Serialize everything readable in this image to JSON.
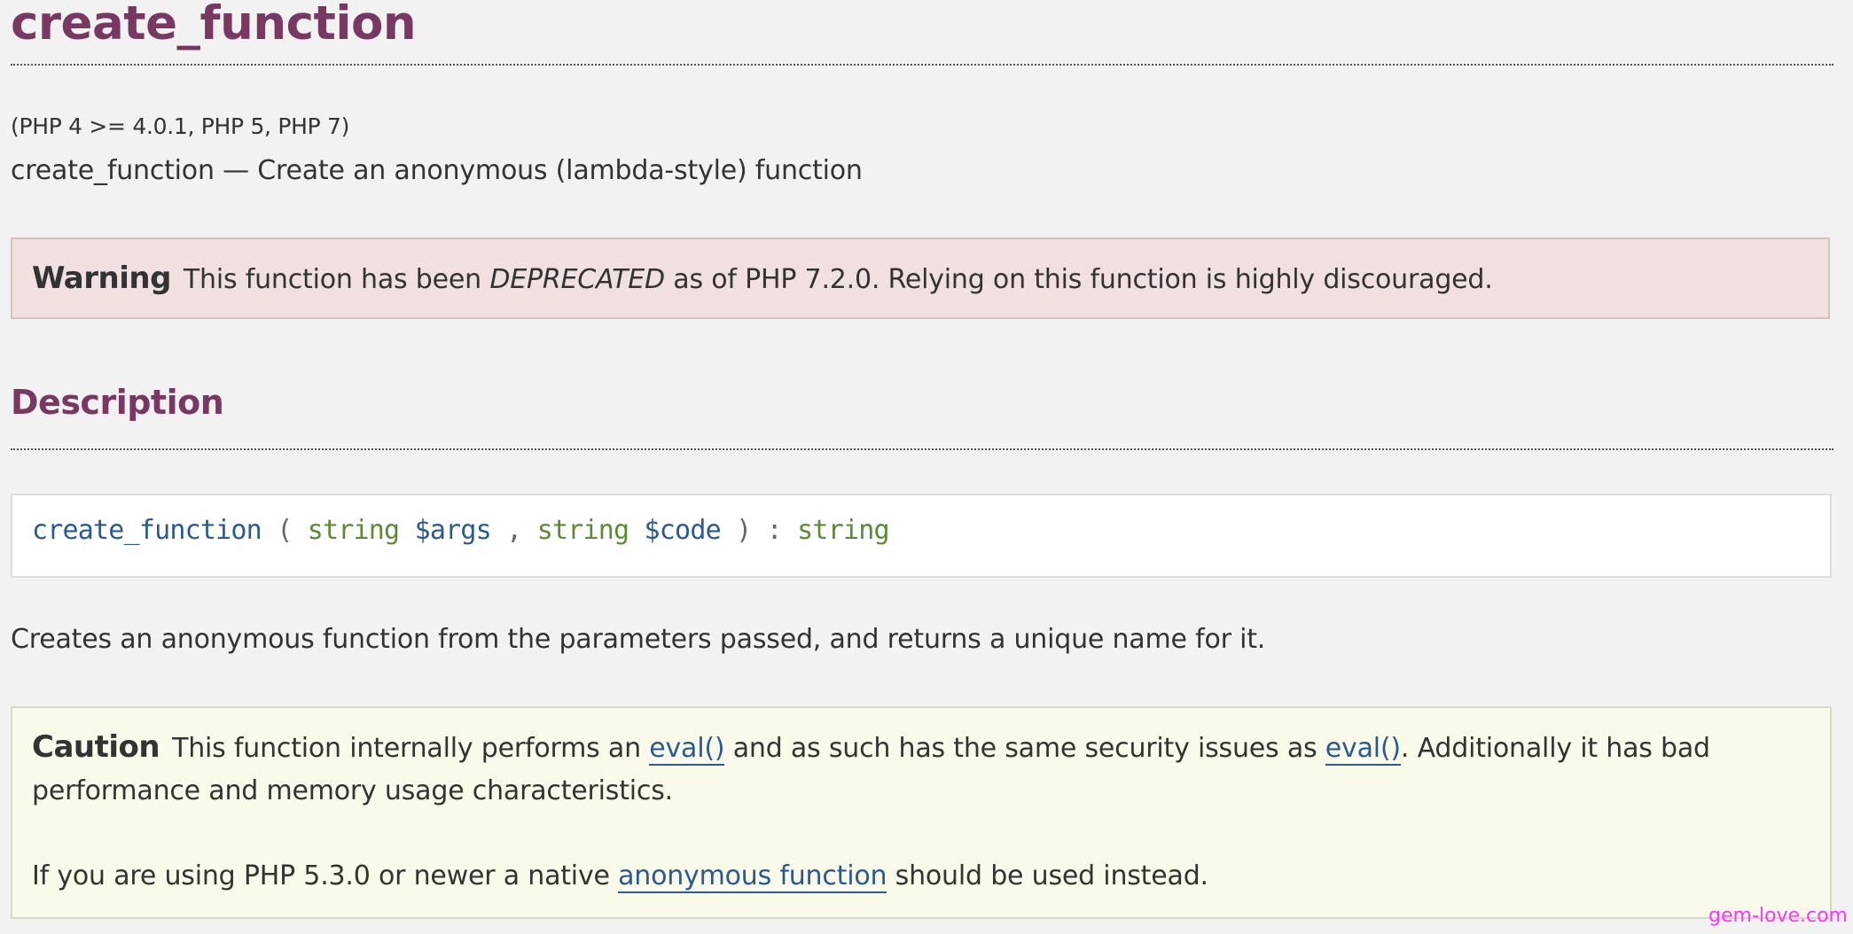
{
  "page": {
    "title": "create_function",
    "version": "(PHP 4 >= 4.0.1, PHP 5, PHP 7)",
    "purpose": "create_function — Create an anonymous (lambda-style) function"
  },
  "warning": {
    "label": "Warning",
    "text_before": "This function has been ",
    "emphasis": "DEPRECATED",
    "text_after": " as of PHP 7.2.0. Relying on this function is highly discouraged."
  },
  "description": {
    "heading": "Description",
    "signature": {
      "function_name": "create_function",
      "open_paren": "(",
      "param1_type": "string",
      "param1_name": "$args",
      "comma": ",",
      "param2_type": "string",
      "param2_name": "$code",
      "close_paren": ")",
      "colon": ":",
      "return_type": "string"
    },
    "text": "Creates an anonymous function from the parameters passed, and returns a unique name for it."
  },
  "caution": {
    "label": "Caution",
    "p1_before": "This function internally performs an ",
    "p1_link1": "eval()",
    "p1_middle": " and as such has the same security issues as ",
    "p1_link2": "eval()",
    "p1_after": ". Additionally it has bad performance and memory usage characteristics.",
    "p2_before": "If you are using PHP 5.3.0 or newer a native ",
    "p2_link": "anonymous function",
    "p2_after": " should be used instead."
  },
  "watermark": "gem-love.com",
  "colors": {
    "heading": "#793862",
    "link": "#2b5a8c",
    "type": "#5c8a35",
    "warning_bg": "#f0e0e0",
    "caution_bg": "#f9fae9",
    "watermark": "#ff33ff"
  }
}
